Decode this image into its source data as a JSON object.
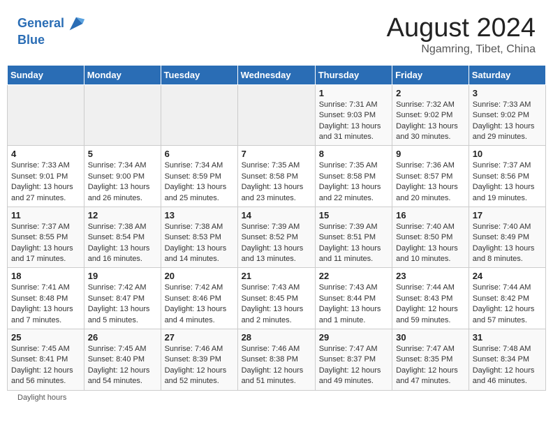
{
  "header": {
    "logo_line1": "General",
    "logo_line2": "Blue",
    "title": "August 2024",
    "subtitle": "Ngamring, Tibet, China"
  },
  "days_of_week": [
    "Sunday",
    "Monday",
    "Tuesday",
    "Wednesday",
    "Thursday",
    "Friday",
    "Saturday"
  ],
  "weeks": [
    [
      {
        "day": "",
        "info": ""
      },
      {
        "day": "",
        "info": ""
      },
      {
        "day": "",
        "info": ""
      },
      {
        "day": "",
        "info": ""
      },
      {
        "day": "1",
        "info": "Sunrise: 7:31 AM\nSunset: 9:03 PM\nDaylight: 13 hours and 31 minutes."
      },
      {
        "day": "2",
        "info": "Sunrise: 7:32 AM\nSunset: 9:02 PM\nDaylight: 13 hours and 30 minutes."
      },
      {
        "day": "3",
        "info": "Sunrise: 7:33 AM\nSunset: 9:02 PM\nDaylight: 13 hours and 29 minutes."
      }
    ],
    [
      {
        "day": "4",
        "info": "Sunrise: 7:33 AM\nSunset: 9:01 PM\nDaylight: 13 hours and 27 minutes."
      },
      {
        "day": "5",
        "info": "Sunrise: 7:34 AM\nSunset: 9:00 PM\nDaylight: 13 hours and 26 minutes."
      },
      {
        "day": "6",
        "info": "Sunrise: 7:34 AM\nSunset: 8:59 PM\nDaylight: 13 hours and 25 minutes."
      },
      {
        "day": "7",
        "info": "Sunrise: 7:35 AM\nSunset: 8:58 PM\nDaylight: 13 hours and 23 minutes."
      },
      {
        "day": "8",
        "info": "Sunrise: 7:35 AM\nSunset: 8:58 PM\nDaylight: 13 hours and 22 minutes."
      },
      {
        "day": "9",
        "info": "Sunrise: 7:36 AM\nSunset: 8:57 PM\nDaylight: 13 hours and 20 minutes."
      },
      {
        "day": "10",
        "info": "Sunrise: 7:37 AM\nSunset: 8:56 PM\nDaylight: 13 hours and 19 minutes."
      }
    ],
    [
      {
        "day": "11",
        "info": "Sunrise: 7:37 AM\nSunset: 8:55 PM\nDaylight: 13 hours and 17 minutes."
      },
      {
        "day": "12",
        "info": "Sunrise: 7:38 AM\nSunset: 8:54 PM\nDaylight: 13 hours and 16 minutes."
      },
      {
        "day": "13",
        "info": "Sunrise: 7:38 AM\nSunset: 8:53 PM\nDaylight: 13 hours and 14 minutes."
      },
      {
        "day": "14",
        "info": "Sunrise: 7:39 AM\nSunset: 8:52 PM\nDaylight: 13 hours and 13 minutes."
      },
      {
        "day": "15",
        "info": "Sunrise: 7:39 AM\nSunset: 8:51 PM\nDaylight: 13 hours and 11 minutes."
      },
      {
        "day": "16",
        "info": "Sunrise: 7:40 AM\nSunset: 8:50 PM\nDaylight: 13 hours and 10 minutes."
      },
      {
        "day": "17",
        "info": "Sunrise: 7:40 AM\nSunset: 8:49 PM\nDaylight: 13 hours and 8 minutes."
      }
    ],
    [
      {
        "day": "18",
        "info": "Sunrise: 7:41 AM\nSunset: 8:48 PM\nDaylight: 13 hours and 7 minutes."
      },
      {
        "day": "19",
        "info": "Sunrise: 7:42 AM\nSunset: 8:47 PM\nDaylight: 13 hours and 5 minutes."
      },
      {
        "day": "20",
        "info": "Sunrise: 7:42 AM\nSunset: 8:46 PM\nDaylight: 13 hours and 4 minutes."
      },
      {
        "day": "21",
        "info": "Sunrise: 7:43 AM\nSunset: 8:45 PM\nDaylight: 13 hours and 2 minutes."
      },
      {
        "day": "22",
        "info": "Sunrise: 7:43 AM\nSunset: 8:44 PM\nDaylight: 13 hours and 1 minute."
      },
      {
        "day": "23",
        "info": "Sunrise: 7:44 AM\nSunset: 8:43 PM\nDaylight: 12 hours and 59 minutes."
      },
      {
        "day": "24",
        "info": "Sunrise: 7:44 AM\nSunset: 8:42 PM\nDaylight: 12 hours and 57 minutes."
      }
    ],
    [
      {
        "day": "25",
        "info": "Sunrise: 7:45 AM\nSunset: 8:41 PM\nDaylight: 12 hours and 56 minutes."
      },
      {
        "day": "26",
        "info": "Sunrise: 7:45 AM\nSunset: 8:40 PM\nDaylight: 12 hours and 54 minutes."
      },
      {
        "day": "27",
        "info": "Sunrise: 7:46 AM\nSunset: 8:39 PM\nDaylight: 12 hours and 52 minutes."
      },
      {
        "day": "28",
        "info": "Sunrise: 7:46 AM\nSunset: 8:38 PM\nDaylight: 12 hours and 51 minutes."
      },
      {
        "day": "29",
        "info": "Sunrise: 7:47 AM\nSunset: 8:37 PM\nDaylight: 12 hours and 49 minutes."
      },
      {
        "day": "30",
        "info": "Sunrise: 7:47 AM\nSunset: 8:35 PM\nDaylight: 12 hours and 47 minutes."
      },
      {
        "day": "31",
        "info": "Sunrise: 7:48 AM\nSunset: 8:34 PM\nDaylight: 12 hours and 46 minutes."
      }
    ]
  ],
  "footer": {
    "daylight_hours_label": "Daylight hours"
  }
}
